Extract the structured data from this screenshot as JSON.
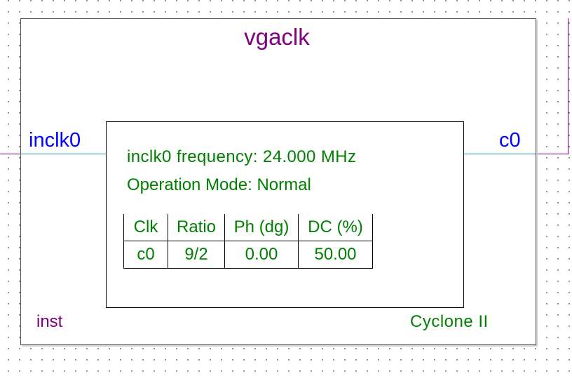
{
  "symbol": {
    "name": "vgaclk",
    "instance": "inst",
    "device_family": "Cyclone II"
  },
  "ports": {
    "input": "inclk0",
    "output": "c0"
  },
  "info": {
    "frequency_line": "inclk0 frequency: 24.000 MHz",
    "mode_line": "Operation Mode: Normal"
  },
  "table": {
    "headers": [
      "Clk",
      "Ratio",
      "Ph (dg)",
      "DC (%)"
    ],
    "rows": [
      [
        "c0",
        "9/2",
        "0.00",
        "50.00"
      ]
    ]
  },
  "colors": {
    "symbol_name": "#800080",
    "port_label": "#0000ff",
    "info_text": "#008000",
    "wire_outer": "#800080",
    "wire_inner": "#2090c0"
  }
}
